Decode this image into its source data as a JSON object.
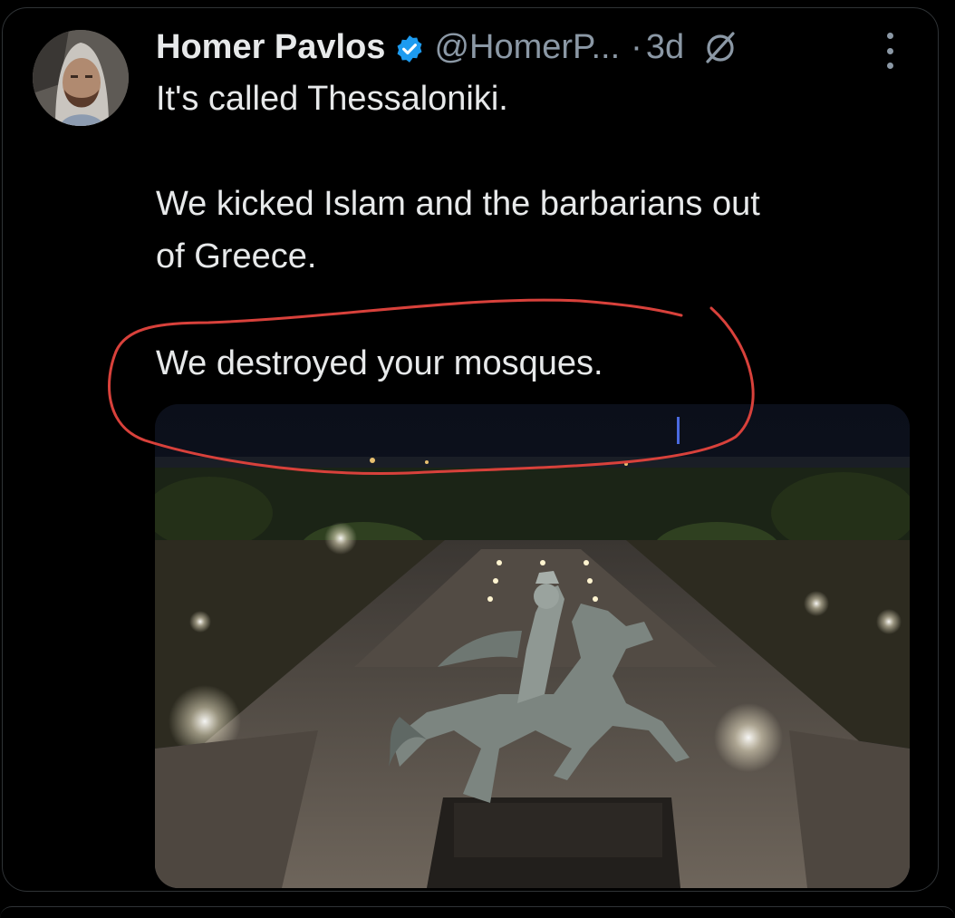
{
  "tweet": {
    "author_name": "Homer Pavlos",
    "handle": "@HomerP...",
    "separator": "·",
    "timestamp": "3d",
    "lines": [
      "It's called Thessaloniki.",
      "We kicked Islam and the barbarians out",
      "of Greece.",
      "We destroyed your mosques."
    ]
  },
  "icons": {
    "verified": "verified-badge-icon",
    "grok": "grok-icon",
    "more": "more-options-icon"
  },
  "colors": {
    "background": "#000000",
    "text": "#e7e9ea",
    "secondary_text": "#8b98a5",
    "verified_blue": "#1d9bf0",
    "annotation_red": "#d8413b"
  }
}
